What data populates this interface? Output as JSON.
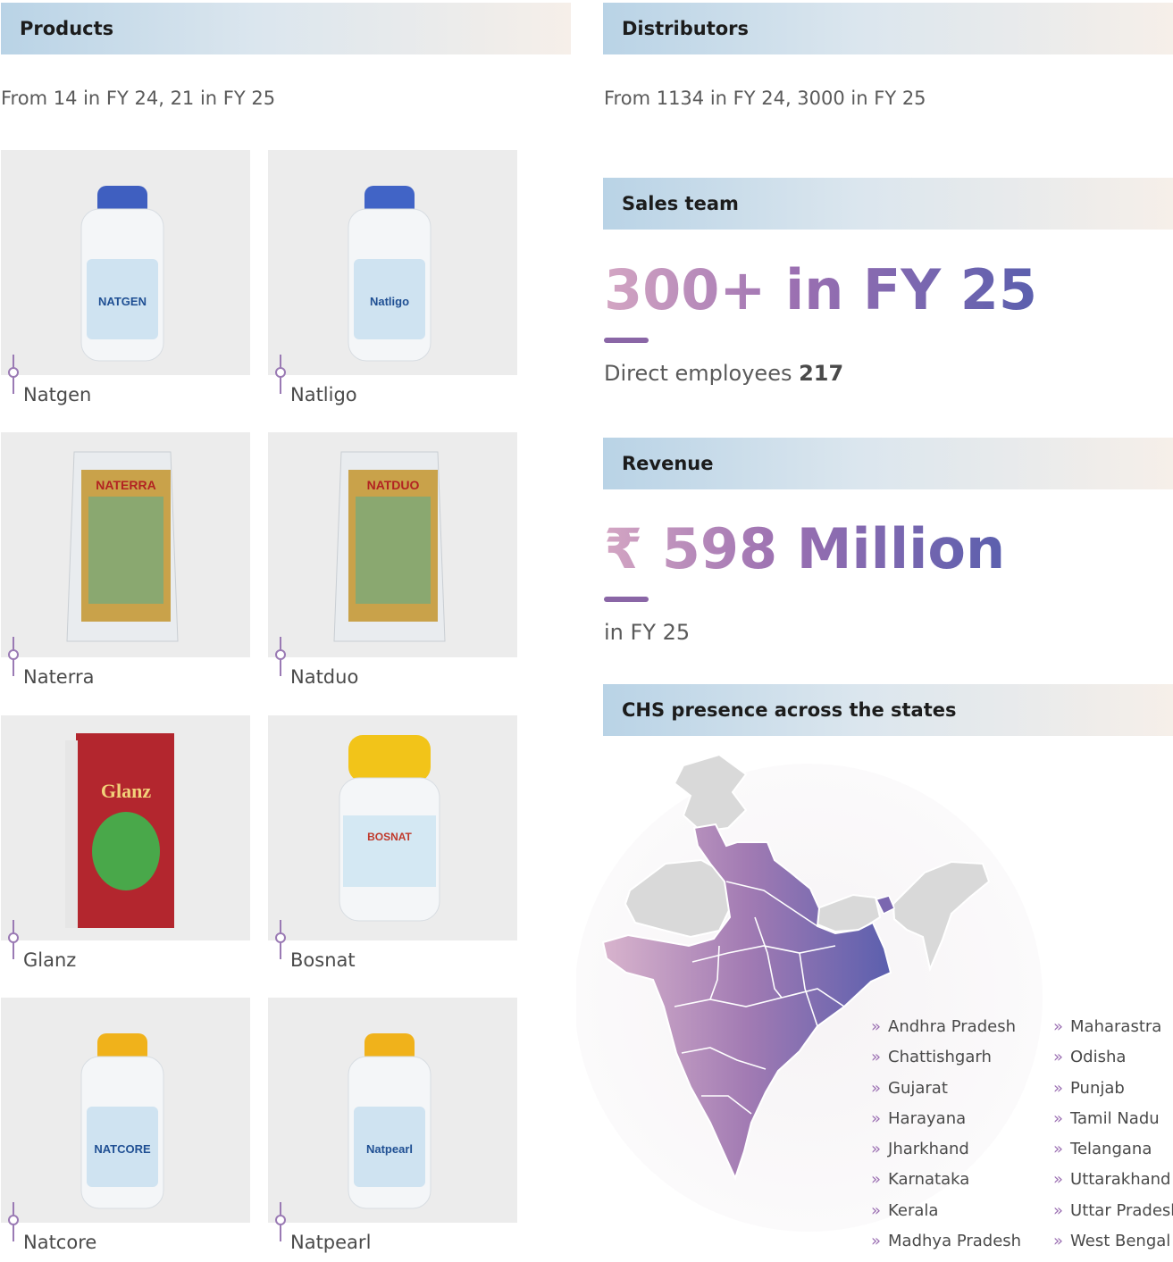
{
  "products": {
    "heading": "Products",
    "subtitle": "From 14 in FY 24, 21 in FY 25",
    "items": [
      {
        "name": "Natgen",
        "label": "NATGEN",
        "icon": "bottle-icon"
      },
      {
        "name": "Natligo",
        "label": "Natligo",
        "icon": "bottle-icon"
      },
      {
        "name": "Naterra",
        "label": "NATERRA",
        "icon": "pouch-icon"
      },
      {
        "name": "Natduo",
        "label": "NATDUO",
        "icon": "pouch-icon"
      },
      {
        "name": "Glanz",
        "label": "Glanz",
        "icon": "box-icon"
      },
      {
        "name": "Bosnat",
        "label": "BOSNAT",
        "icon": "jar-icon"
      },
      {
        "name": "Natcore",
        "label": "NATCORE",
        "icon": "bottle-icon"
      },
      {
        "name": "Natpearl",
        "label": "Natpearl",
        "icon": "bottle-icon"
      }
    ]
  },
  "distributors": {
    "heading": "Distributors",
    "subtitle": "From 1134 in FY 24, 3000 in FY 25"
  },
  "sales": {
    "heading": "Sales team",
    "figure": "300+ in FY 25",
    "caption_prefix": "Direct employees",
    "caption_value": "217"
  },
  "revenue": {
    "heading": "Revenue",
    "figure": "₹ 598 Million",
    "caption": "in FY 25"
  },
  "presence": {
    "heading": "CHS presence across the states",
    "map_icon": "india-map-icon",
    "states_col1": [
      "Andhra Pradesh",
      "Chattishgarh",
      "Gujarat",
      "Harayana",
      "Jharkhand",
      "Karnataka",
      "Kerala",
      "Madhya Pradesh"
    ],
    "states_col2": [
      "Maharastra",
      "Odisha",
      "Punjab",
      "Tamil Nadu",
      "Telangana",
      "Uttarakhand",
      "Uttar Pradesh",
      "West Bengal"
    ]
  },
  "colors": {
    "accent": "#8a66a6",
    "gradient_start": "#d4a6c3",
    "gradient_end": "#5b5fae",
    "map_grey": "#d9d9d9"
  }
}
